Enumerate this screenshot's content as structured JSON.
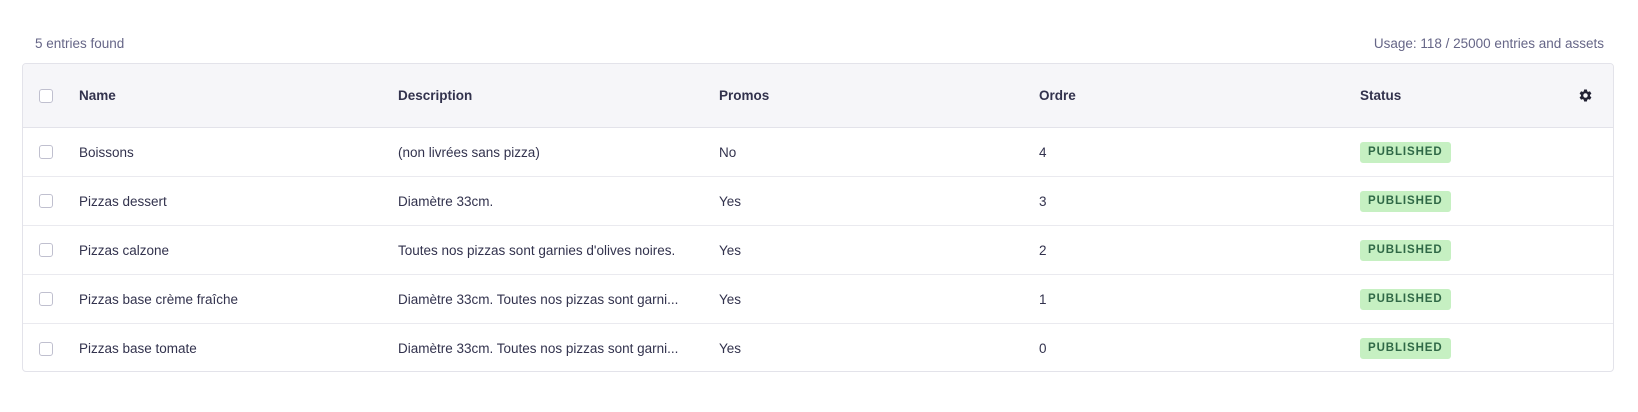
{
  "summary": {
    "entries_found": "5 entries found",
    "usage": "Usage: 118 / 25000 entries and assets"
  },
  "table": {
    "headers": {
      "name": "Name",
      "description": "Description",
      "promos": "Promos",
      "ordre": "Ordre",
      "status": "Status"
    },
    "settings_icon": "gear-icon",
    "rows": [
      {
        "name": "Boissons",
        "description": "(non livrées sans pizza)",
        "promos": "No",
        "ordre": "4",
        "status": "PUBLISHED"
      },
      {
        "name": "Pizzas dessert",
        "description": "Diamètre 33cm.",
        "promos": "Yes",
        "ordre": "3",
        "status": "PUBLISHED"
      },
      {
        "name": "Pizzas calzone",
        "description": "Toutes nos pizzas sont garnies d'olives noires.",
        "promos": "Yes",
        "ordre": "2",
        "status": "PUBLISHED"
      },
      {
        "name": "Pizzas base crème fraîche",
        "description": "Diamètre 33cm. Toutes nos pizzas sont garni...",
        "promos": "Yes",
        "ordre": "1",
        "status": "PUBLISHED"
      },
      {
        "name": "Pizzas base tomate",
        "description": "Diamètre 33cm. Toutes nos pizzas sont garni...",
        "promos": "Yes",
        "ordre": "0",
        "status": "PUBLISHED"
      }
    ]
  },
  "colors": {
    "published_badge_bg": "#c6f0c2",
    "published_badge_text": "#2f6846",
    "header_bg": "#f6f6f9"
  }
}
